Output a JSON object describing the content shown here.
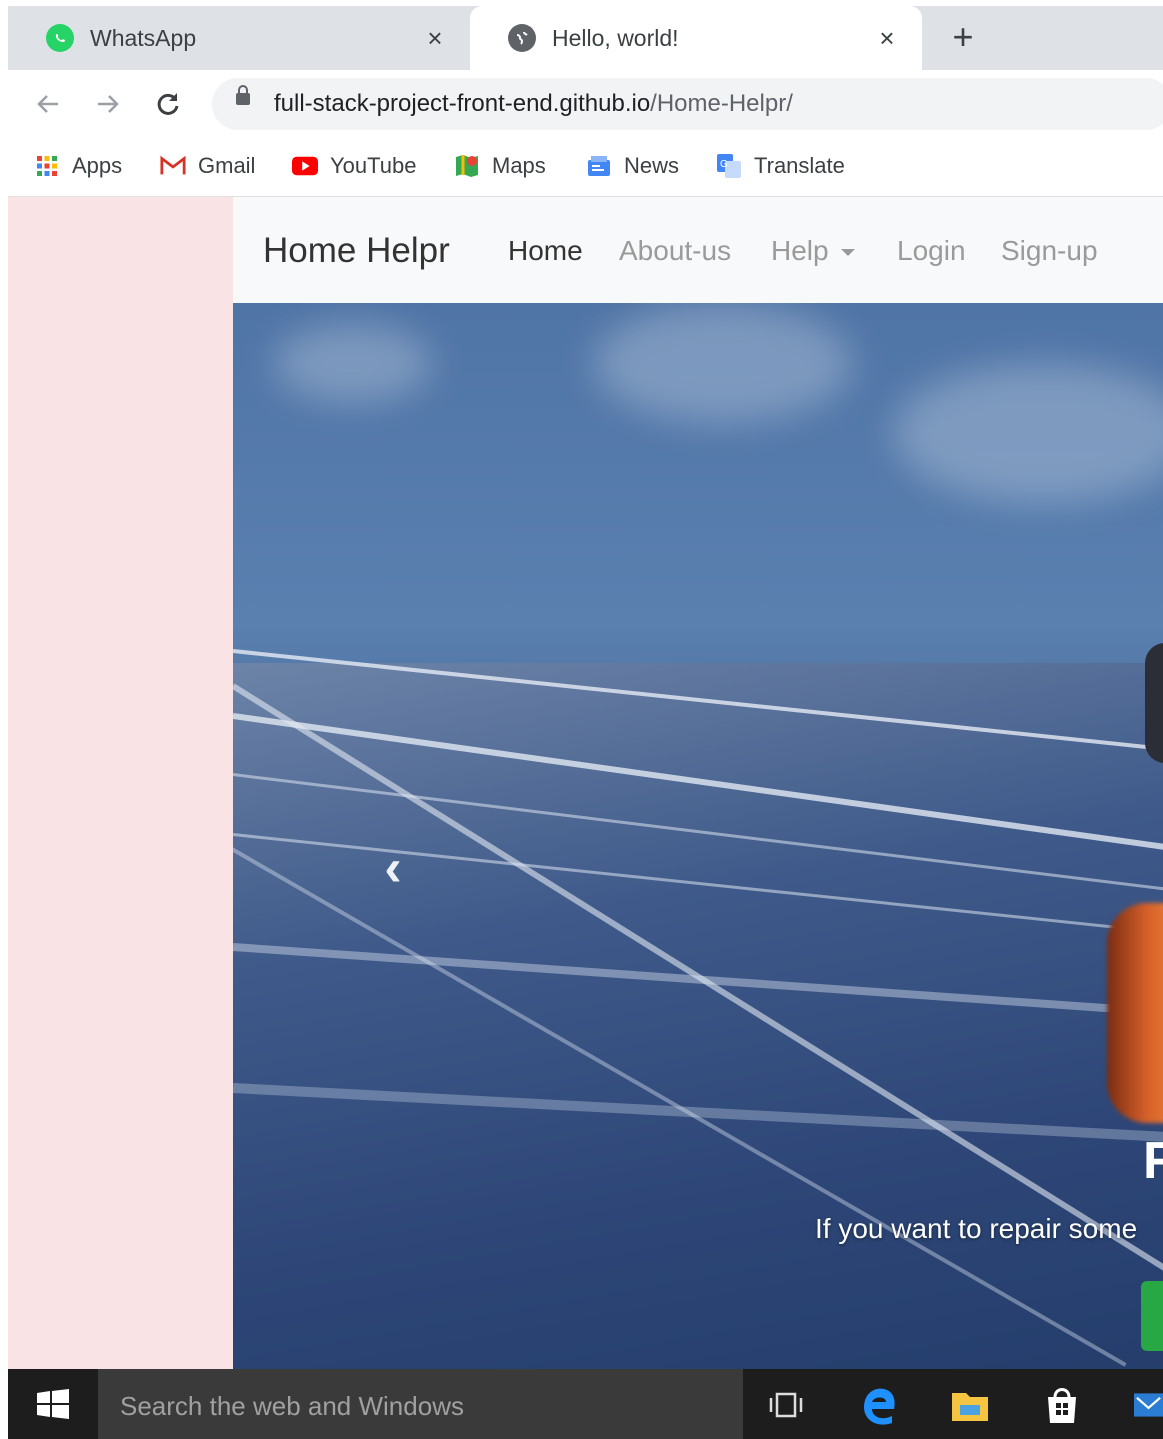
{
  "browser": {
    "tabs": [
      {
        "title": "WhatsApp",
        "icon": "whatsapp-icon",
        "active": false
      },
      {
        "title": "Hello, world!",
        "icon": "globe-icon",
        "active": true
      }
    ],
    "new_tab_symbol": "+",
    "close_symbol": "×",
    "url": {
      "host": "full-stack-project-front-end.github.io",
      "path": "/Home-Helpr/"
    },
    "bookmarks": [
      {
        "label": "Apps",
        "icon": "apps-grid-icon"
      },
      {
        "label": "Gmail",
        "icon": "gmail-icon"
      },
      {
        "label": "YouTube",
        "icon": "youtube-icon"
      },
      {
        "label": "Maps",
        "icon": "maps-icon"
      },
      {
        "label": "News",
        "icon": "news-icon"
      },
      {
        "label": "Translate",
        "icon": "translate-icon"
      }
    ]
  },
  "site": {
    "brand": "Home Helpr",
    "nav": [
      {
        "label": "Home",
        "active": true
      },
      {
        "label": "About-us",
        "active": false
      },
      {
        "label": "Help",
        "active": false,
        "dropdown": true
      },
      {
        "label": "Login",
        "active": false
      },
      {
        "label": "Sign-up",
        "active": false
      }
    ],
    "carousel": {
      "prev_symbol": "‹",
      "caption_title": "R",
      "caption_text": "If you want to repair some"
    }
  },
  "taskbar": {
    "search_placeholder": "Search the web and Windows",
    "icons": [
      "task-view-icon",
      "edge-icon",
      "file-explorer-icon",
      "store-icon",
      "mail-icon"
    ]
  },
  "colors": {
    "page_background": "#fae3e4",
    "navbar_background": "#f8f9fa",
    "accent_green": "#28a745",
    "taskbar": "#1d1d1d"
  }
}
